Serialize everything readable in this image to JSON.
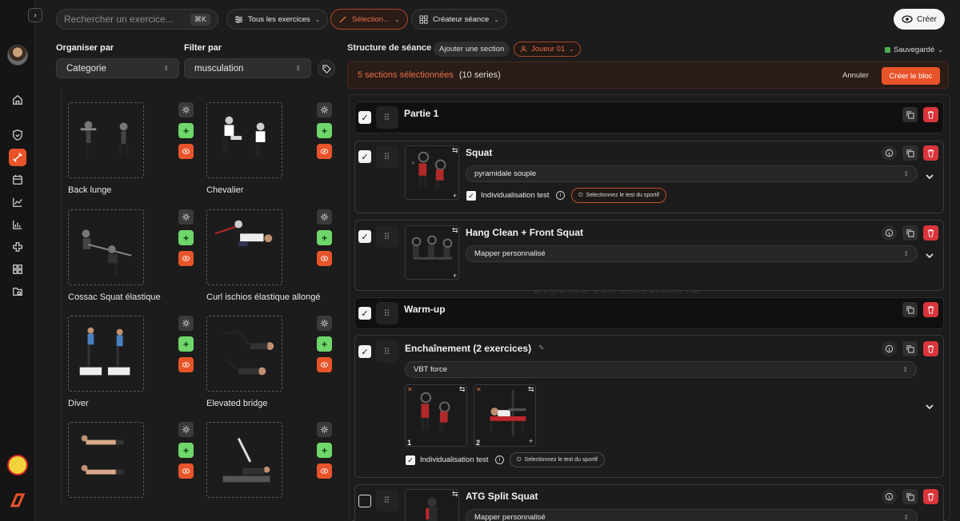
{
  "topbar": {
    "search_placeholder": "Rechercher un exercice...",
    "shortcut": "⌘K",
    "all_exercises": "Tous les exercices",
    "selection": "Sélection...",
    "session_creator": "Créateur séance",
    "create": "Créer"
  },
  "filters": {
    "organize_label": "Organiser par",
    "organize_value": "Categorie",
    "filter_label": "Filter par",
    "filter_value": "musculation"
  },
  "exercises": [
    {
      "name": "Back lunge"
    },
    {
      "name": "Chevalier"
    },
    {
      "name": "Cossac Squat élastique"
    },
    {
      "name": "Curl ischios élastique allongé"
    },
    {
      "name": "Diver"
    },
    {
      "name": "Elevated bridge"
    },
    {
      "name": ""
    },
    {
      "name": ""
    }
  ],
  "structure": {
    "title": "Structure de séance",
    "add_section": "Ajouter une section",
    "player": "Joueur 01",
    "saved": "Sauvegardé",
    "dropzone": "Déposez vos exercices ici",
    "banner": {
      "selected": "5 sections sélectionnées",
      "series": "(10 series)",
      "cancel": "Annuler",
      "create_block": "Créer le bloc"
    },
    "sections": [
      {
        "title": "Partie 1"
      },
      {
        "title": "Squat",
        "method": "pyramidale souple",
        "individualisation": "Individualisation test",
        "test_button": "Selectionnez le test du sportif"
      },
      {
        "title": "Hang Clean + Front Squat",
        "method": "Mapper personnalisé"
      },
      {
        "title": "Warm-up"
      },
      {
        "title": "Enchaînement (2 exercices)",
        "method": "VBT force",
        "individualisation": "Individualisation test",
        "test_button": "Selectionnez le test du sportif",
        "items": [
          "1",
          "2"
        ]
      },
      {
        "title": "ATG Split Squat",
        "method": "Mapper personnalisé"
      }
    ]
  }
}
